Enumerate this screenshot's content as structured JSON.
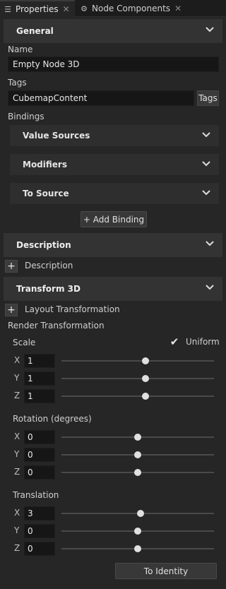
{
  "tabs": {
    "properties": {
      "label": "Properties",
      "icon": "list-icon"
    },
    "node_components": {
      "label": "Node Components",
      "icon": "components-icon"
    }
  },
  "general": {
    "header": "General",
    "name_label": "Name",
    "name_value": "Empty Node 3D",
    "tags_label": "Tags",
    "tags_value": "CubemapContent",
    "tags_button": "Tags",
    "bindings_label": "Bindings",
    "value_sources": "Value Sources",
    "modifiers": "Modifiers",
    "to_source": "To Source",
    "add_binding": "+ Add Binding"
  },
  "description": {
    "header": "Description",
    "add_label": "Description"
  },
  "transform": {
    "header": "Transform 3D",
    "layout_label": "Layout Transformation",
    "render_label": "Render Transformation",
    "scale": {
      "label": "Scale",
      "uniform_label": "Uniform",
      "uniform": true,
      "x": "1",
      "y": "1",
      "z": "1",
      "x_slider": 0.55,
      "y_slider": 0.55,
      "z_slider": 0.55
    },
    "rotation": {
      "label": "Rotation (degrees)",
      "x": "0",
      "y": "0",
      "z": "0",
      "x_slider": 0.5,
      "y_slider": 0.5,
      "z_slider": 0.5
    },
    "translation": {
      "label": "Translation",
      "x": "3",
      "y": "0",
      "z": "0",
      "x_slider": 0.52,
      "y_slider": 0.5,
      "z_slider": 0.5
    },
    "to_identity": "To Identity"
  },
  "axes": {
    "x": "X",
    "y": "Y",
    "z": "Z"
  },
  "colors": {
    "background": "#262626",
    "section": "#333333",
    "field": "#161616"
  }
}
